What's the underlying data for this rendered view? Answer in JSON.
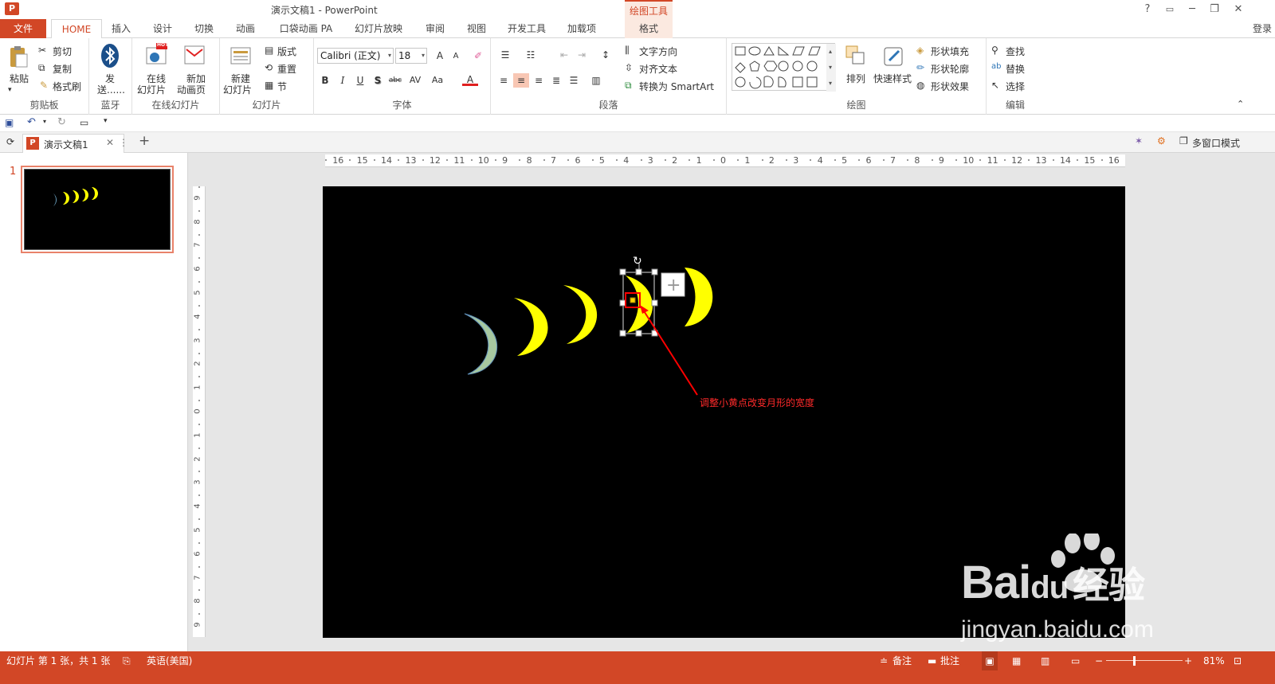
{
  "window": {
    "title": "演示文稿1 - PowerPoint",
    "context_tools": "绘图工具",
    "help": "?",
    "ribbon_display": "▭",
    "minimize": "─",
    "restore": "❐",
    "close": "✕",
    "login": "登录"
  },
  "tabs": {
    "file": "文件",
    "items": [
      "HOME",
      "插入",
      "设计",
      "切换",
      "动画",
      "口袋动画 PA",
      "幻灯片放映",
      "审阅",
      "视图",
      "开发工具",
      "加载项",
      "格式"
    ]
  },
  "ribbon": {
    "clipboard": {
      "paste": "粘贴",
      "cut": "剪切",
      "copy": "复制",
      "format_painter": "格式刷",
      "label": "剪贴板"
    },
    "bluetooth": {
      "send_line1": "发",
      "send_line2": "送......",
      "label": "蓝牙"
    },
    "online_slides": {
      "online_line1": "在线",
      "online_line2": "幻灯片",
      "new_page_line1": "新加",
      "new_page_line2": "动画页",
      "hot_badge": "HOT",
      "label": "在线幻灯片"
    },
    "slides": {
      "new_line1": "新建",
      "new_line2": "幻灯片",
      "layout": "版式",
      "reset": "重置",
      "section": "节",
      "label": "幻灯片"
    },
    "font": {
      "family": "Calibri (正文)",
      "size": "18",
      "bold": "B",
      "italic": "I",
      "underline": "U",
      "shadow": "S",
      "strike": "abc",
      "spacing": "AV",
      "case": "Aa",
      "color": "A",
      "grow": "A",
      "shrink": "A",
      "label": "字体"
    },
    "paragraph": {
      "text_direction": "文字方向",
      "align_text": "对齐文本",
      "smartart": "转换为 SmartArt",
      "label": "段落"
    },
    "drawing": {
      "arrange": "排列",
      "quick_styles": "快速样式",
      "fill": "形状填充",
      "outline": "形状轮廓",
      "effects": "形状效果",
      "label": "绘图"
    },
    "editing": {
      "find": "查找",
      "replace": "替换",
      "select": "选择",
      "label": "编辑"
    }
  },
  "doc_tab": {
    "name": "演示文稿1",
    "add": "+"
  },
  "multi_window": "多窗口模式",
  "thumbnail": {
    "number": "1"
  },
  "annotation": {
    "text": "调整小黄点改变月形的宽度"
  },
  "status": {
    "slide_info": "幻灯片 第 1 张，共 1 张",
    "language": "英语(美国)",
    "notes": "备注",
    "comments": "批注",
    "zoom": "81%"
  },
  "watermark": {
    "brand": "Bai",
    "brand2": "du",
    "sub": "经验",
    "url": "jingyan.baidu.com"
  },
  "ruler": {
    "h_ticks": [
      "16",
      "15",
      "14",
      "13",
      "12",
      "11",
      "10",
      "9",
      "8",
      "7",
      "6",
      "5",
      "4",
      "3",
      "2",
      "1",
      "0",
      "1",
      "2",
      "3",
      "4",
      "5",
      "6",
      "7",
      "8",
      "9",
      "10",
      "11",
      "12",
      "13",
      "14",
      "15",
      "16"
    ],
    "v_ticks": [
      "9",
      "8",
      "7",
      "6",
      "5",
      "4",
      "3",
      "2",
      "1",
      "0",
      "1",
      "2",
      "3",
      "4",
      "5",
      "6",
      "7",
      "8",
      "9"
    ]
  },
  "colors": {
    "accent": "#d24726",
    "moon": "#ffff00",
    "annotation": "#ff0000"
  }
}
